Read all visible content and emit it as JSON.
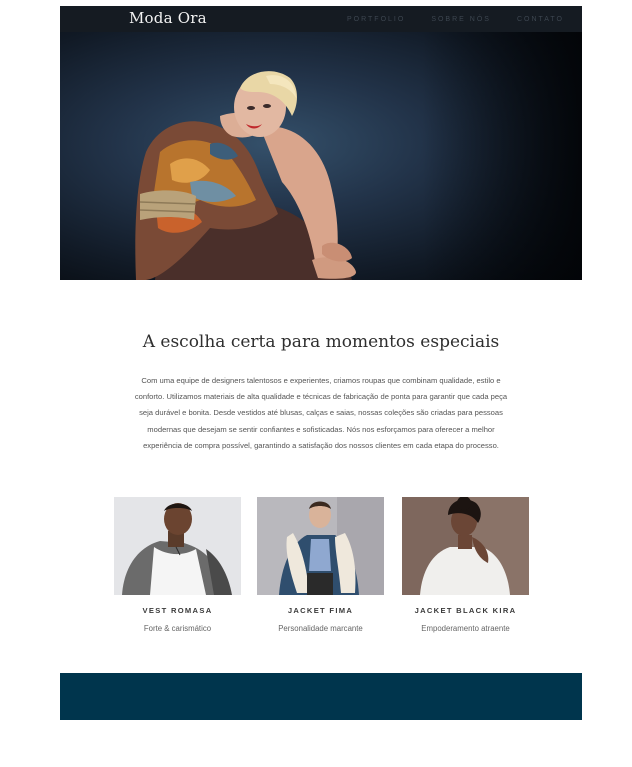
{
  "header": {
    "brand": "Moda Ora",
    "nav": [
      {
        "label": "PORTFOLIO"
      },
      {
        "label": "SOBRE NÓS"
      },
      {
        "label": "CONTATO"
      }
    ]
  },
  "intro": {
    "title": "A escolha certa para momentos especiais",
    "lines": [
      "Com uma equipe de designers talentosos e experientes, criamos roupas que combinam qualidade, estilo e",
      "conforto. Utilizamos materiais de alta qualidade e técnicas de fabricação de ponta para garantir que cada peça",
      "seja durável e bonita. Desde vestidos até blusas, calças e saias, nossas coleções são criadas para pessoas",
      "modernas que desejam se sentir confiantes e sofisticadas. Nós nos esforçamos para oferecer a melhor",
      "experiência de compra possível, garantindo a satisfação dos nossos clientes em cada etapa do processo."
    ]
  },
  "products": [
    {
      "name": "VEST ROMASA",
      "description": "Forte & carismático"
    },
    {
      "name": "JACKET FIMA",
      "description": "Personalidade marcante"
    },
    {
      "name": "JACKET BLACK KIRA",
      "description": "Empoderamento atraente"
    }
  ],
  "colors": {
    "header_bg": "#151b22",
    "footer_bg": "#00354d",
    "nav_text": "#3d4650"
  }
}
